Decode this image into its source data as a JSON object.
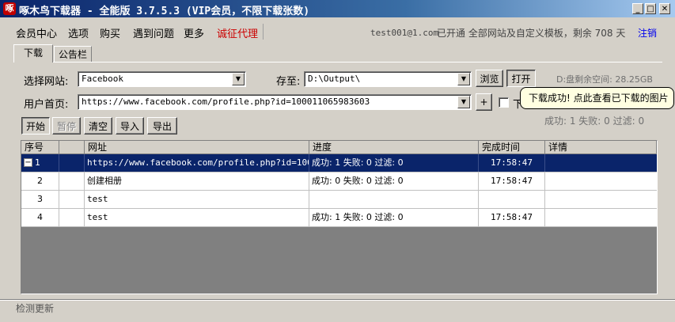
{
  "window": {
    "title": "啄木鸟下载器 - 全能版 3.7.5.3 (VIP会员，不限下载张数)",
    "icon_text": "啄"
  },
  "menu": {
    "items": [
      "会员中心",
      "选项",
      "购买",
      "遇到问题",
      "更多"
    ],
    "highlight": "诚征代理",
    "highlight_color": "#cc0000",
    "account": "test001@1.com",
    "status": "已开通 全部网站及自定义模板，剩余 708 天",
    "logout": "注销"
  },
  "tabs": [
    {
      "label": "下载",
      "active": true
    },
    {
      "label": "公告栏",
      "active": false
    }
  ],
  "form": {
    "site_label": "选择网站:",
    "site_value": "Facebook",
    "save_label": "存至:",
    "save_value": "D:\\Output\\",
    "browse": "浏览",
    "open": "打开",
    "disk_space": "D:盘剩余空间: 28.25GB",
    "homepage_label": "用户首页:",
    "homepage_value": "https://www.facebook.com/profile.php?id=100011065983603",
    "plus": "+",
    "checkbox_label": "下",
    "summary": "成功: 1 失败: 0 过滤: 0"
  },
  "tooltip": "下载成功! 点此查看已下载的图片",
  "toolbar": {
    "start": "开始",
    "pause": "暂停",
    "clear": "清空",
    "import": "导入",
    "export": "导出"
  },
  "table": {
    "columns": [
      "序号",
      "网址",
      "进度",
      "完成时间",
      "详情"
    ],
    "rows": [
      {
        "index": "1",
        "url": "https://www.facebook.com/profile.php?id=100...",
        "progress": "成功: 1 失败: 0 过滤: 0",
        "time": "17:58:47",
        "detail": "",
        "expander": "−"
      },
      {
        "index": "2",
        "url": "创建相册",
        "progress": "成功: 0 失败: 0 过滤: 0",
        "time": "17:58:47",
        "detail": ""
      },
      {
        "index": "3",
        "url": "test",
        "progress": "",
        "time": "",
        "detail": ""
      },
      {
        "index": "4",
        "url": "test",
        "progress": "成功: 1 失败: 0 过滤: 0",
        "time": "17:58:47",
        "detail": ""
      }
    ]
  },
  "statusbar": {
    "text": "检测更新"
  }
}
